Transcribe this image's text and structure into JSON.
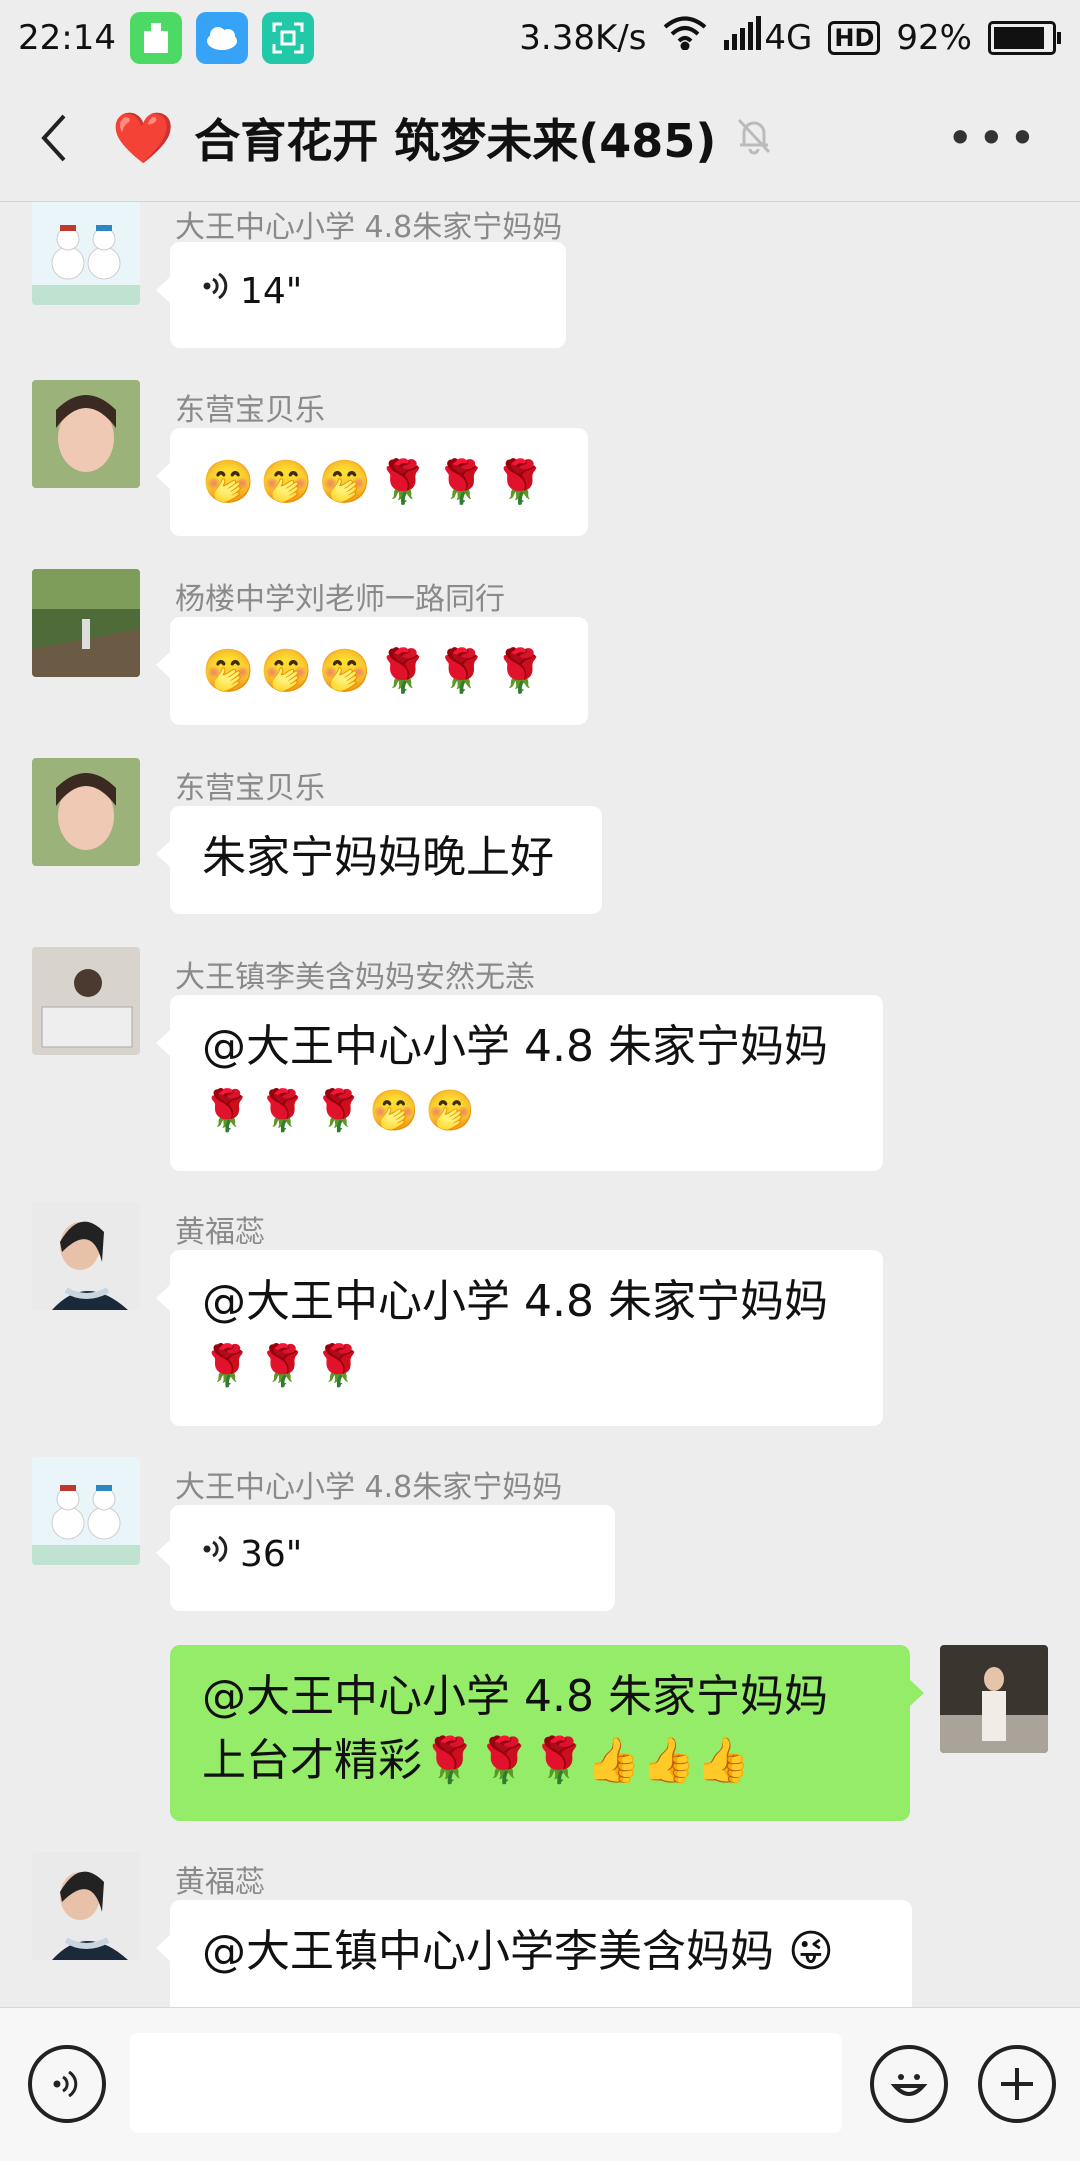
{
  "status": {
    "time": "22:14",
    "speed": "3.38K/s",
    "network": "4G",
    "hd": "HD",
    "battery": "92%"
  },
  "header": {
    "title": "合育花开 筑梦未来(485)",
    "heart": "❤️"
  },
  "messages": [
    {
      "name": "大王中心小学 4.8朱家宁妈妈",
      "duration": "14\""
    },
    {
      "name": "东营宝贝乐",
      "text": "🤭🤭🤭🌹🌹🌹"
    },
    {
      "name": "杨楼中学刘老师一路同行",
      "text": "🤭🤭🤭🌹🌹🌹"
    },
    {
      "name": "东营宝贝乐",
      "text": "朱家宁妈妈晚上好"
    },
    {
      "name": "大王镇李美含妈妈安然无恙",
      "line1": "@大王中心小学 4.8 朱家宁妈妈",
      "line2": "🌹🌹🌹🤭🤭"
    },
    {
      "name": "黄福蕊",
      "line1": "@大王中心小学 4.8 朱家宁妈妈",
      "line2": "🌹🌹🌹"
    },
    {
      "name": "大王中心小学 4.8朱家宁妈妈",
      "duration": "36\""
    },
    {
      "line1": "@大王中心小学 4.8 朱家宁妈妈",
      "line2": "上台才精彩🌹🌹🌹👍👍👍"
    },
    {
      "name": "黄福蕊",
      "line1": "@大王镇中心小学李美含妈妈 😜"
    }
  ]
}
